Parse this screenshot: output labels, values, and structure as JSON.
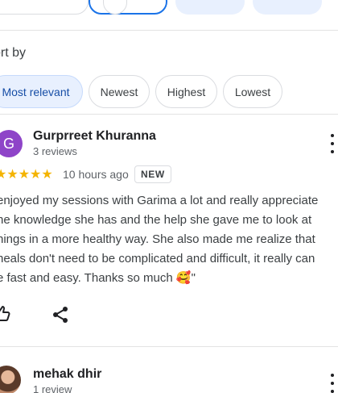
{
  "sort": {
    "label": "ort by",
    "options": [
      {
        "label": "Most relevant",
        "active": true
      },
      {
        "label": "Newest",
        "active": false
      },
      {
        "label": "Highest",
        "active": false
      },
      {
        "label": "Lowest",
        "active": false
      }
    ]
  },
  "reviews": [
    {
      "avatar_letter": "G",
      "avatar_color": "#8e44c8",
      "name": "Gurprreet Khuranna",
      "review_count": "3 reviews",
      "stars": "★★★★★",
      "rating": 5,
      "time": "10 hours ago",
      "badge": "NEW",
      "text_lines": [
        "enjoyed my sessions with Garima a lot and really appreciate",
        "he knowledge she has and the help she gave me to look at",
        "hings in a more healthy way. She also made me realize that",
        "neals don't need to be complicated and difficult, it really can",
        "e fast and easy. Thanks so much 🥰\""
      ],
      "actions": {
        "like_icon": "thumbs-up-icon",
        "share_icon": "share-icon"
      }
    },
    {
      "avatar_icon": "profile-photo",
      "name": "mehak dhir",
      "review_count": "1 review"
    }
  ],
  "colors": {
    "accent": "#1a73e8",
    "chip_active_bg": "#e8f0fe",
    "star": "#f4b400",
    "text_secondary": "#5f6368"
  }
}
